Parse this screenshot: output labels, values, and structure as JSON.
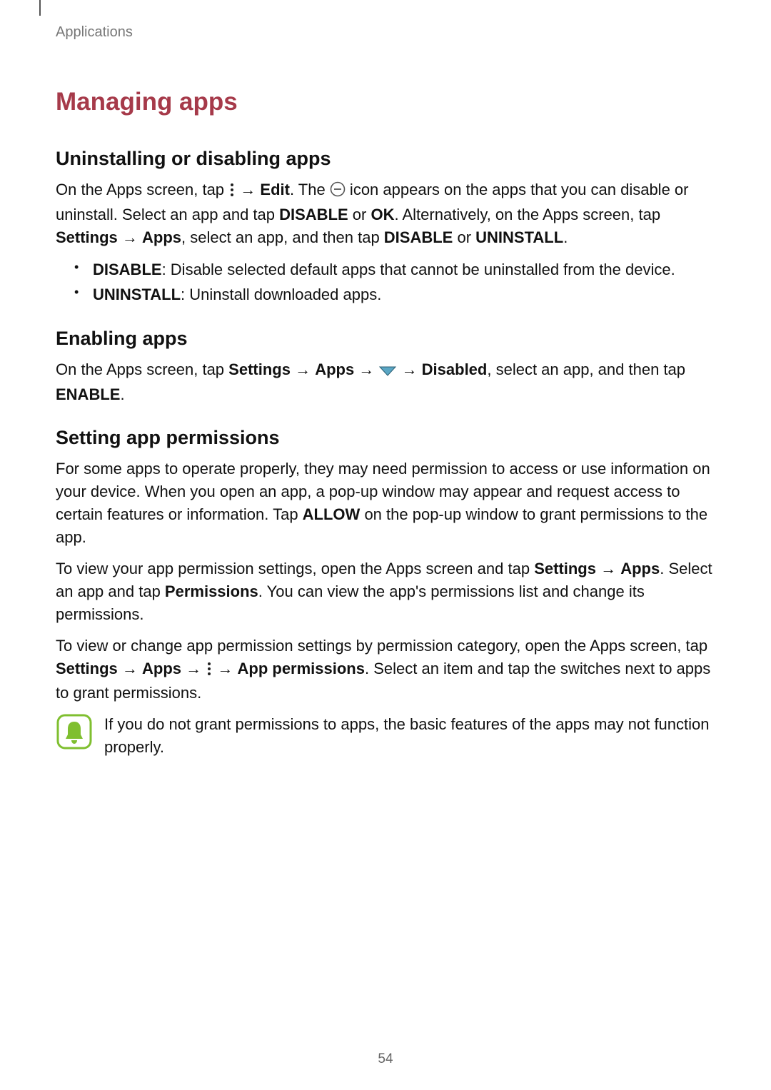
{
  "page": {
    "breadcrumb": "Applications",
    "number": "54"
  },
  "section": {
    "title": "Managing apps"
  },
  "uninstall": {
    "heading": "Uninstalling or disabling apps",
    "p_part1": "On the Apps screen, tap ",
    "arrow1": " → ",
    "edit": "Edit",
    "p_part2": ". The ",
    "p_part3": " icon appears on the apps that you can disable or uninstall. Select an app and tap ",
    "disable": "DISABLE",
    "or1": " or ",
    "ok": "OK",
    "p_part4": ". Alternatively, on the Apps screen, tap ",
    "settings": "Settings",
    "arrow2": " → ",
    "apps": "Apps",
    "p_part5": ", select an app, and then tap ",
    "disable2": "DISABLE",
    "or2": " or ",
    "uninstall": "UNINSTALL",
    "p_part6": ".",
    "bullet1_b": "DISABLE",
    "bullet1_t": ": Disable selected default apps that cannot be uninstalled from the device.",
    "bullet2_b": "UNINSTALL",
    "bullet2_t": ": Uninstall downloaded apps."
  },
  "enable": {
    "heading": "Enabling apps",
    "p_part1": "On the Apps screen, tap ",
    "settings": "Settings",
    "arrow1": " → ",
    "apps": "Apps",
    "arrow2": " → ",
    "arrow3": " → ",
    "disabled": "Disabled",
    "p_part2": ", select an app, and then tap ",
    "enable_b": "ENABLE",
    "p_part3": "."
  },
  "perm": {
    "heading": "Setting app permissions",
    "p1_a": "For some apps to operate properly, they may need permission to access or use information on your device. When you open an app, a pop-up window may appear and request access to certain features or information. Tap ",
    "allow": "ALLOW",
    "p1_b": " on the pop-up window to grant permissions to the app.",
    "p2_a": "To view your app permission settings, open the Apps screen and tap ",
    "settings": "Settings",
    "arrow1": " → ",
    "apps": "Apps",
    "p2_b": ". Select an app and tap ",
    "permissions": "Permissions",
    "p2_c": ". You can view the app's permissions list and change its permissions.",
    "p3_a": "To view or change app permission settings by permission category, open the Apps screen, tap ",
    "settings2": "Settings",
    "arrow2": " → ",
    "apps2": "Apps",
    "arrow3": " → ",
    "arrow4": " → ",
    "app_permissions": "App permissions",
    "p3_b": ". Select an item and tap the switches next to apps to grant permissions.",
    "note": "If you do not grant permissions to apps, the basic features of the apps may not function properly."
  }
}
